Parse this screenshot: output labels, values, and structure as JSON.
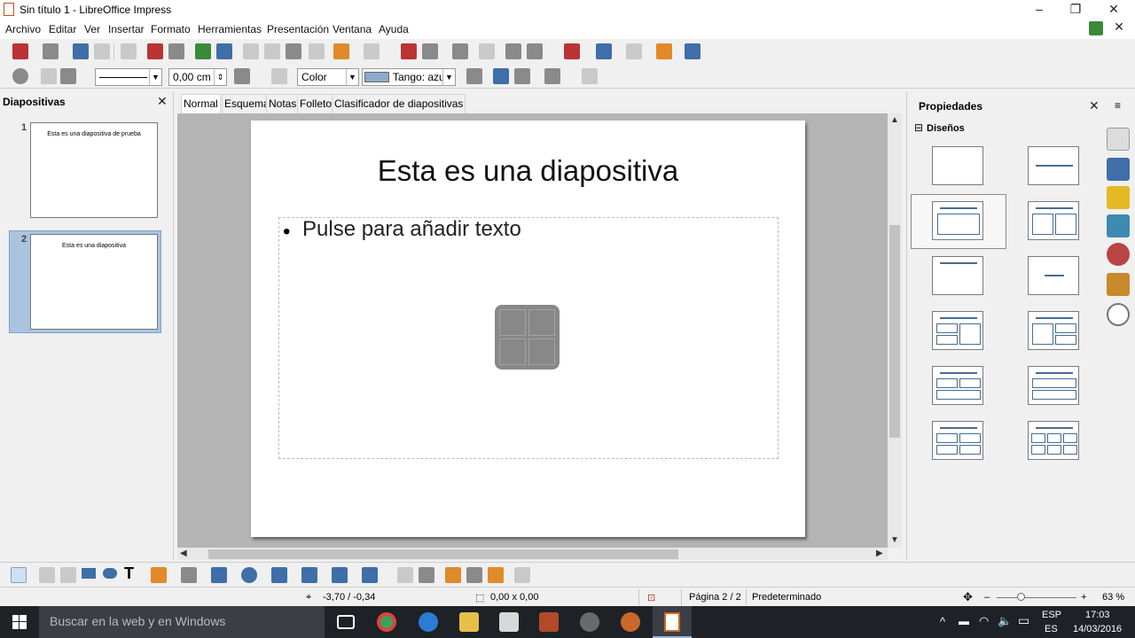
{
  "window": {
    "title": "Sin título 1 - LibreOffice Impress"
  },
  "menu": [
    "Archivo",
    "Editar",
    "Ver",
    "Insertar",
    "Formato",
    "Herramientas",
    "Presentación",
    "Ventana",
    "Ayuda"
  ],
  "format_toolbar": {
    "line_width_value": "0,00 cm",
    "area_style": "Color",
    "area_color": "Tango: azu",
    "area_color_hex": "#8eaacb"
  },
  "slides_pane": {
    "title": "Diapositivas",
    "slides": [
      {
        "number": "1",
        "text": "Esta es una diapositiva de prueba"
      },
      {
        "number": "2",
        "text": "Esta es una diapositiva"
      }
    ]
  },
  "view_tabs": [
    "Normal",
    "Esquema",
    "Notas",
    "Folleto",
    "Clasificador de diapositivas"
  ],
  "slide": {
    "title": "Esta es una diapositiva",
    "bullet": "•",
    "placeholder": "Pulse para añadir texto"
  },
  "properties_pane": {
    "title": "Propiedades",
    "section": "Diseños",
    "collapse_symbol": "⊟"
  },
  "status_bar": {
    "position": "-3,70 / -0,34",
    "size": "0,00 x 0,00",
    "page": "Página 2 / 2",
    "master": "Predeterminado",
    "zoom": "63 %"
  },
  "taskbar": {
    "search_placeholder": "Buscar en la web y en Windows",
    "lang_top": "ESP",
    "lang_bottom": "ES",
    "time": "17:03",
    "date": "14/03/2016"
  },
  "colors": {
    "accent": "#476d93",
    "selection": "#aac4e0",
    "taskbar": "#1e2126"
  }
}
